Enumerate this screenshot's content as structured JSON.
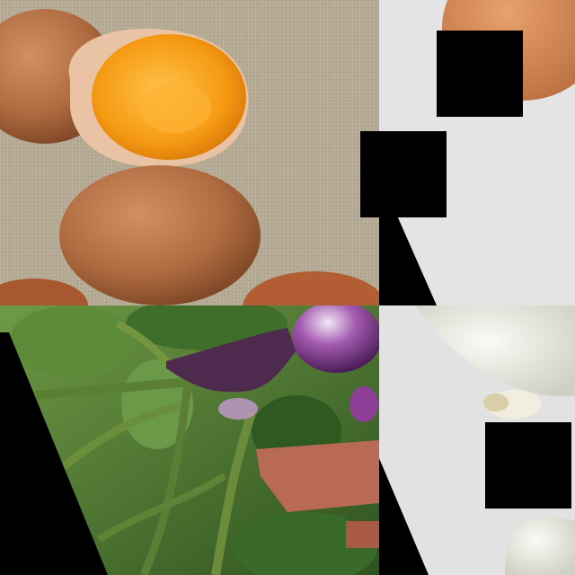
{
  "scene": {
    "tiles": [
      {
        "id": "eggs",
        "subject": "eggs-with-open-yolk-on-linen"
      },
      {
        "id": "egg-white",
        "subject": "egg-on-white-background"
      },
      {
        "id": "eggplant",
        "subject": "eggplant-plant-with-stems"
      },
      {
        "id": "garlic",
        "subject": "garlic-bulb-on-white"
      }
    ],
    "masks": 3,
    "colors": {
      "linen": "#bfb39c",
      "egg_shell": "#b8754a",
      "yolk": "#f7a21b",
      "leaf": "#4f7d34",
      "eggplant": "#5a2c5f",
      "background_white": "#e6e6e6",
      "mask": "#000000"
    }
  }
}
